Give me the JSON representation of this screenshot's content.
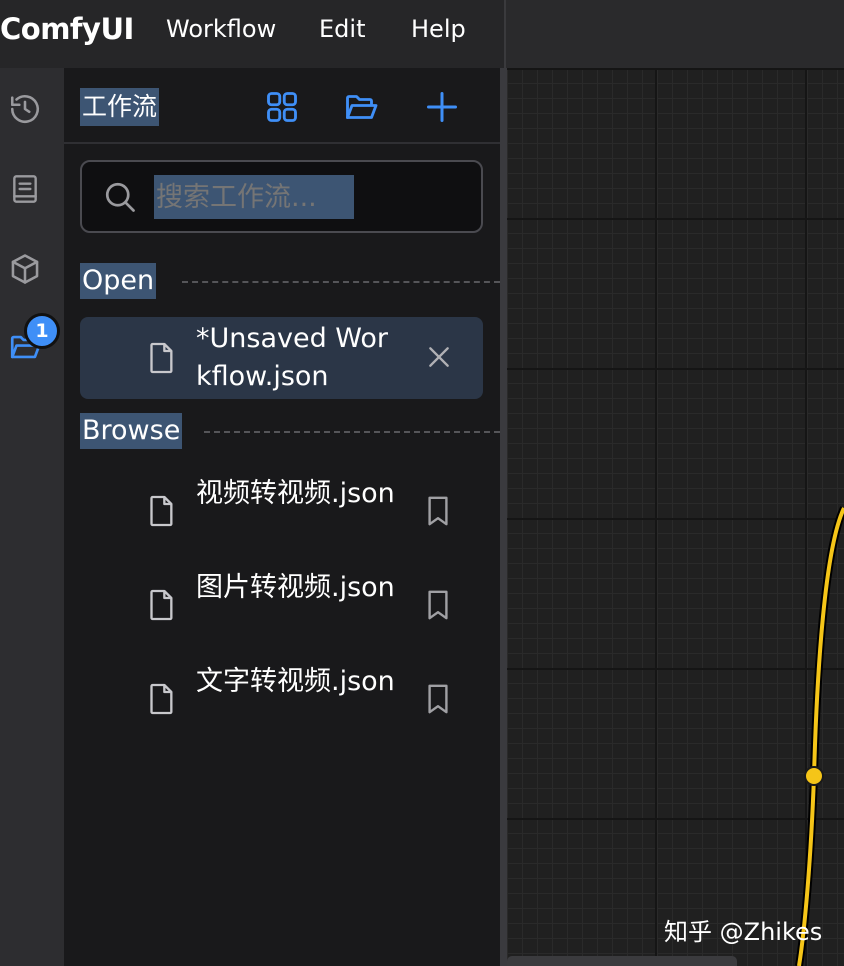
{
  "app": {
    "logo": "ComfyUI",
    "menu": [
      "Workflow",
      "Edit",
      "Help"
    ]
  },
  "rail": {
    "icons": [
      "history-icon",
      "book-icon",
      "cube-icon",
      "folder-open-icon"
    ],
    "badge_count": "1"
  },
  "sidebar": {
    "title": "工作流",
    "header_icons": [
      "grid-icon",
      "folder-open-icon",
      "plus-icon"
    ],
    "search": {
      "placeholder": "搜索工作流..."
    },
    "open_section": {
      "label": "Open",
      "items": [
        {
          "name": "*Unsaved Workflow.json"
        }
      ]
    },
    "browse_section": {
      "label": "Browse",
      "items": [
        {
          "name": "视频转视频.json"
        },
        {
          "name": "图片转视频.json"
        },
        {
          "name": "文字转视频.json"
        }
      ]
    }
  },
  "canvas": {
    "link_color": "#f5c518"
  },
  "watermark": "知乎 @Zhikes",
  "colors": {
    "accent": "#3f8ff7",
    "selection": "#3d5573",
    "panel_bg": "#19191b"
  }
}
